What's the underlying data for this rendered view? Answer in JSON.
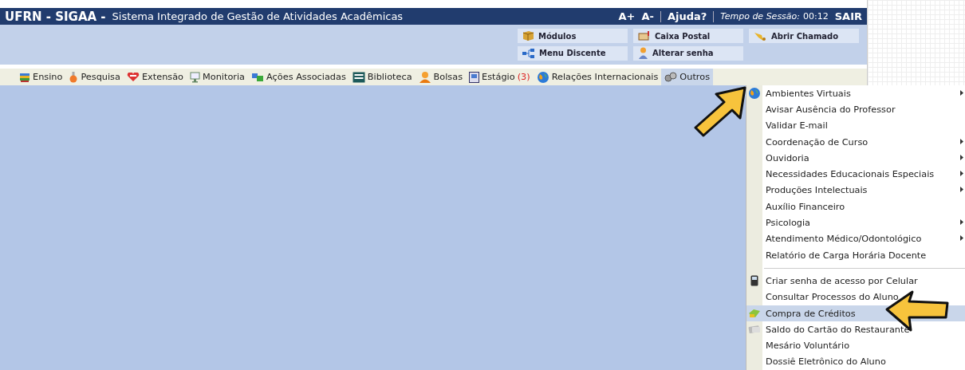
{
  "header": {
    "brand": "UFRN - SIGAA -",
    "system_name": "Sistema Integrado de Gestão de Atividades Acadêmicas",
    "font_larger": "A+",
    "font_smaller": "A-",
    "help": "Ajuda?",
    "session_label": "Tempo de Sessão:",
    "session_time": "00:12",
    "logout": "SAIR"
  },
  "quick_links": [
    {
      "label": "Módulos"
    },
    {
      "label": "Caixa Postal"
    },
    {
      "label": "Abrir Chamado"
    },
    {
      "label": "Menu Discente"
    },
    {
      "label": "Alterar senha"
    }
  ],
  "menu_bar": [
    {
      "label": "Ensino",
      "selected": false
    },
    {
      "label": "Pesquisa",
      "selected": false
    },
    {
      "label": "Extensão",
      "selected": false
    },
    {
      "label": "Monitoria",
      "selected": false
    },
    {
      "label": "Ações Associadas",
      "selected": false
    },
    {
      "label": "Biblioteca",
      "selected": false
    },
    {
      "label": "Bolsas",
      "selected": false
    },
    {
      "label": "Estágio",
      "count": "(3)",
      "selected": false
    },
    {
      "label": "Relações Internacionais",
      "selected": false
    },
    {
      "label": "Outros",
      "selected": true
    }
  ],
  "dropdown": [
    {
      "kind": "item",
      "label": "Ambientes Virtuais",
      "has_icon": true,
      "submenu": true,
      "selected": false
    },
    {
      "kind": "item",
      "label": "Avisar Ausência do Professor",
      "has_icon": false,
      "submenu": false,
      "selected": false
    },
    {
      "kind": "item",
      "label": "Validar E-mail",
      "has_icon": false,
      "submenu": false,
      "selected": false
    },
    {
      "kind": "item",
      "label": "Coordenação de Curso",
      "has_icon": false,
      "submenu": true,
      "selected": false
    },
    {
      "kind": "item",
      "label": "Ouvidoria",
      "has_icon": false,
      "submenu": true,
      "selected": false
    },
    {
      "kind": "item",
      "label": "Necessidades Educacionais Especiais",
      "has_icon": false,
      "submenu": true,
      "selected": false
    },
    {
      "kind": "item",
      "label": "Produções Intelectuais",
      "has_icon": false,
      "submenu": true,
      "selected": false
    },
    {
      "kind": "item",
      "label": "Auxílio Financeiro",
      "has_icon": false,
      "submenu": false,
      "selected": false
    },
    {
      "kind": "item",
      "label": "Psicologia",
      "has_icon": false,
      "submenu": true,
      "selected": false
    },
    {
      "kind": "item",
      "label": "Atendimento Médico/Odontológico",
      "has_icon": false,
      "submenu": true,
      "selected": false
    },
    {
      "kind": "item",
      "label": "Relatório de Carga Horária Docente",
      "has_icon": false,
      "submenu": false,
      "selected": false
    },
    {
      "kind": "separator"
    },
    {
      "kind": "item",
      "label": "Criar senha de acesso por Celular",
      "has_icon": true,
      "submenu": false,
      "selected": false
    },
    {
      "kind": "item",
      "label": "Consultar Processos do Aluno",
      "has_icon": false,
      "submenu": false,
      "selected": false
    },
    {
      "kind": "item",
      "label": "Compra de Créditos",
      "has_icon": true,
      "submenu": false,
      "selected": true
    },
    {
      "kind": "item",
      "label": "Saldo do Cartão do Restaurante",
      "has_icon": true,
      "submenu": false,
      "selected": false
    },
    {
      "kind": "item",
      "label": "Mesário Voluntário",
      "has_icon": false,
      "submenu": false,
      "selected": false
    },
    {
      "kind": "item",
      "label": "Dossiê Eletrônico do Aluno",
      "has_icon": false,
      "submenu": false,
      "selected": false
    }
  ]
}
